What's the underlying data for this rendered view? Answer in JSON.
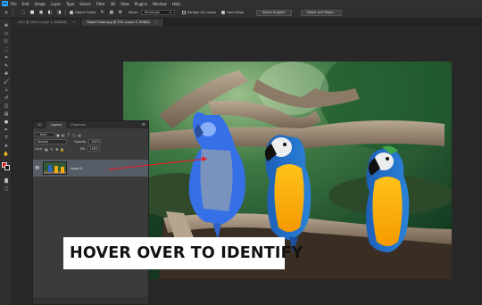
{
  "menu": {
    "logo": "Ps",
    "items": [
      "File",
      "Edit",
      "Image",
      "Layer",
      "Type",
      "Select",
      "Filter",
      "3D",
      "View",
      "Plugins",
      "Window",
      "Help"
    ]
  },
  "options": {
    "object_finder_label": "Object Finder",
    "mode_label": "Mode:",
    "mode_value": "Rectangle",
    "sample_all_layers": "Sample All Layers",
    "hard_edge": "Hard Edge",
    "select_subject": "Select Subject",
    "select_and_mask": "Select and Mask..."
  },
  "tabs": [
    {
      "label": "sill-1 @ 100% (Layer 1, RGB/8#)",
      "active": false
    },
    {
      "label": "Object Finder.jpg @ 25% (Layer 0, RGB/8)",
      "active": true
    }
  ],
  "layers_panel": {
    "tabs": [
      "3D",
      "Layers",
      "Channels"
    ],
    "kind_label": "Kind",
    "blend_mode": "Normal",
    "opacity_label": "Opacity:",
    "opacity_value": "100%",
    "lock_label": "Lock:",
    "fill_label": "Fill:",
    "fill_value": "100%",
    "layer_name": "Layer 0"
  },
  "caption": "HOVER OVER TO IDENTIFY",
  "colors": {
    "accent": "#31a8ff",
    "highlight_overlay": "#3b7bff",
    "arrow": "#e0202a",
    "foreground_swatch": "#e01010"
  }
}
